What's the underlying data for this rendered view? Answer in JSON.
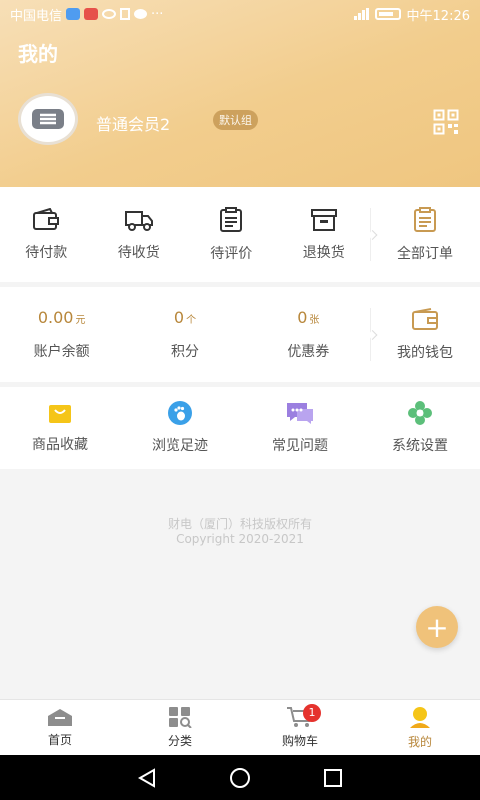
{
  "status": {
    "carrier": "中国电信",
    "more": "···",
    "time": "中午12:26"
  },
  "header": {
    "title": "我的",
    "username": "普通会员2",
    "group": "默认组"
  },
  "orders": {
    "items": [
      {
        "label": "待付款",
        "icon": "wallet-icon"
      },
      {
        "label": "待收货",
        "icon": "truck-icon"
      },
      {
        "label": "待评价",
        "icon": "clipboard-icon"
      },
      {
        "label": "退换货",
        "icon": "box-icon"
      }
    ],
    "all": {
      "label": "全部订单",
      "icon": "order-list-icon"
    }
  },
  "assets": {
    "items": [
      {
        "value": "0.00",
        "unit": "元",
        "label": "账户余额"
      },
      {
        "value": "0",
        "unit": "个",
        "label": "积分"
      },
      {
        "value": "0",
        "unit": "张",
        "label": "优惠券"
      }
    ],
    "wallet": {
      "label": "我的钱包",
      "icon": "wallet-icon"
    }
  },
  "services": {
    "items": [
      {
        "label": "商品收藏",
        "icon": "shopping-bag-icon",
        "color": "#f5c518"
      },
      {
        "label": "浏览足迹",
        "icon": "footprint-icon",
        "color": "#3aa0e8"
      },
      {
        "label": "常见问题",
        "icon": "chat-icon",
        "color": "#9b7fe0"
      },
      {
        "label": "系统设置",
        "icon": "flower-settings-icon",
        "color": "#5cbf7a"
      }
    ]
  },
  "footer": {
    "line1": "财电（厦门）科技版权所有",
    "line2": "Copyright 2020-2021"
  },
  "tabbar": {
    "items": [
      {
        "label": "首页",
        "icon": "home-icon"
      },
      {
        "label": "分类",
        "icon": "category-icon"
      },
      {
        "label": "购物车",
        "icon": "cart-icon",
        "badge": "1"
      },
      {
        "label": "我的",
        "icon": "user-icon"
      }
    ]
  },
  "colors": {
    "accent": "#b8873b",
    "header_gradient_start": "#f7dfb7",
    "header_gradient_end": "#efc680",
    "badge_red": "#e5322d"
  }
}
